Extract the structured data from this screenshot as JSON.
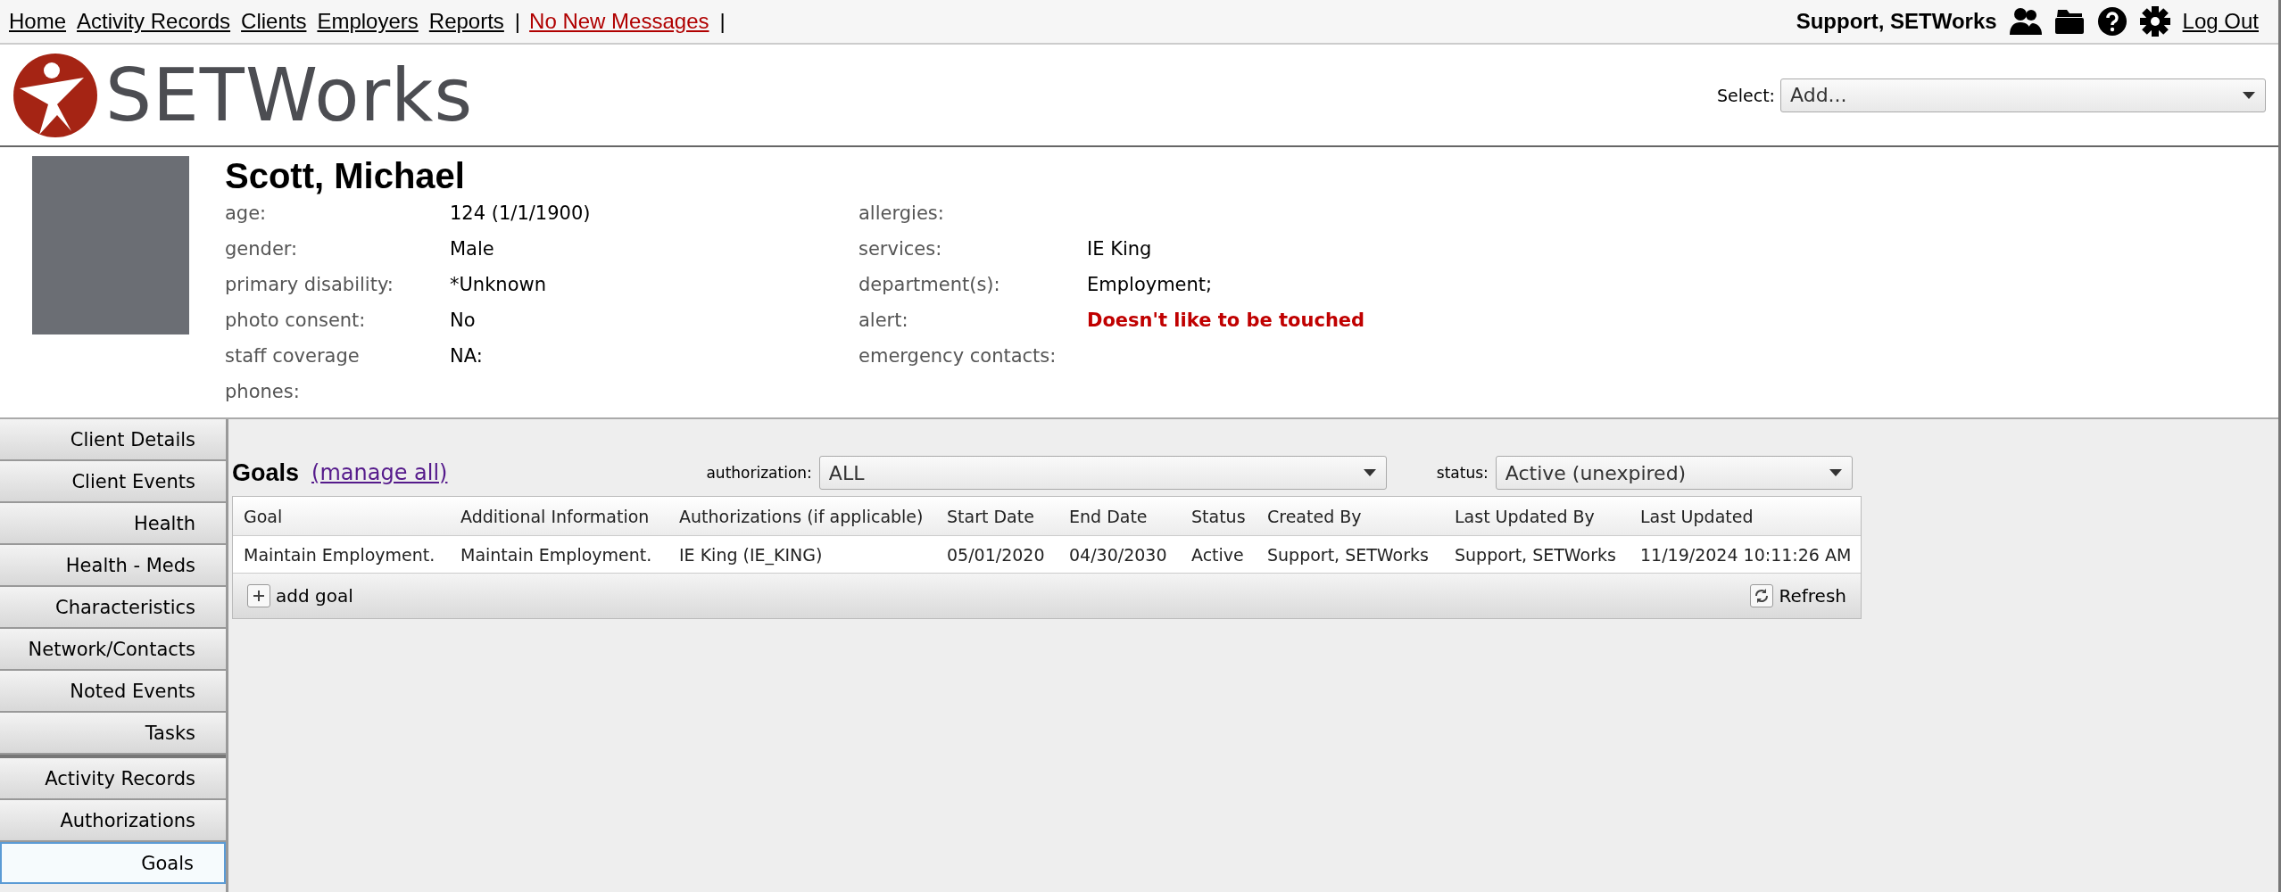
{
  "top_nav": {
    "links": [
      "Home",
      "Activity Records",
      "Clients",
      "Employers",
      "Reports"
    ],
    "separators": [
      "|",
      "|"
    ],
    "messages": "No New Messages",
    "user": "Support, SETWorks",
    "logout": "Log Out"
  },
  "logo": {
    "text": "SETWorks"
  },
  "select": {
    "label": "Select:",
    "value": "Add..."
  },
  "client": {
    "name": "Scott, Michael",
    "left_fields": [
      {
        "label": "age:",
        "value": "124 (1/1/1900)"
      },
      {
        "label": "gender:",
        "value": "Male"
      },
      {
        "label": "primary disability:",
        "value": "*Unknown"
      },
      {
        "label": "photo consent:",
        "value": "No"
      },
      {
        "label": "staff coverage",
        "value": "NA:"
      },
      {
        "label": "phones:"
      }
    ],
    "right_fields": [
      {
        "label": "allergies:"
      },
      {
        "label": "services:",
        "value": "IE King"
      },
      {
        "label": "department(s):",
        "value": "Employment;"
      },
      {
        "label": "alert:",
        "value": "Doesn't like to be touched",
        "kind": "alert"
      },
      {
        "label": "emergency contacts:"
      }
    ]
  },
  "sidebar": {
    "groups": [
      [
        {
          "label": "Client Details",
          "selected": false
        },
        {
          "label": "Client Events",
          "selected": false
        },
        {
          "label": "Health",
          "selected": false
        },
        {
          "label": "Health - Meds",
          "selected": false
        },
        {
          "label": "Characteristics",
          "selected": false
        },
        {
          "label": "Network/Contacts",
          "selected": false
        },
        {
          "label": "Noted Events",
          "selected": false
        },
        {
          "label": "Tasks",
          "selected": false
        }
      ],
      [
        {
          "label": "Activity Records",
          "selected": false
        },
        {
          "label": "Authorizations",
          "selected": false
        },
        {
          "label": "Goals",
          "selected": true
        }
      ]
    ]
  },
  "goals": {
    "title": "Goals",
    "manage_link": "(manage all)",
    "authorization_filter": {
      "label": "authorization:",
      "value": "ALL"
    },
    "status_filter": {
      "label": "status:",
      "value": "Active (unexpired)"
    },
    "table": {
      "columns": [
        "Goal",
        "Additional Information",
        "Authorizations (if applicable)",
        "Start Date",
        "End Date",
        "Status",
        "Created By",
        "Last Updated By",
        "Last Updated"
      ],
      "rows": [
        [
          "Maintain Employment.",
          "Maintain Employment.",
          "IE King (IE_KING)",
          "05/01/2020",
          "04/30/2030",
          "Active",
          "Support, SETWorks",
          "Support, SETWorks",
          "11/19/2024 10:11:26 AM"
        ]
      ]
    },
    "add_button": "add goal",
    "refresh_button": "Refresh"
  }
}
